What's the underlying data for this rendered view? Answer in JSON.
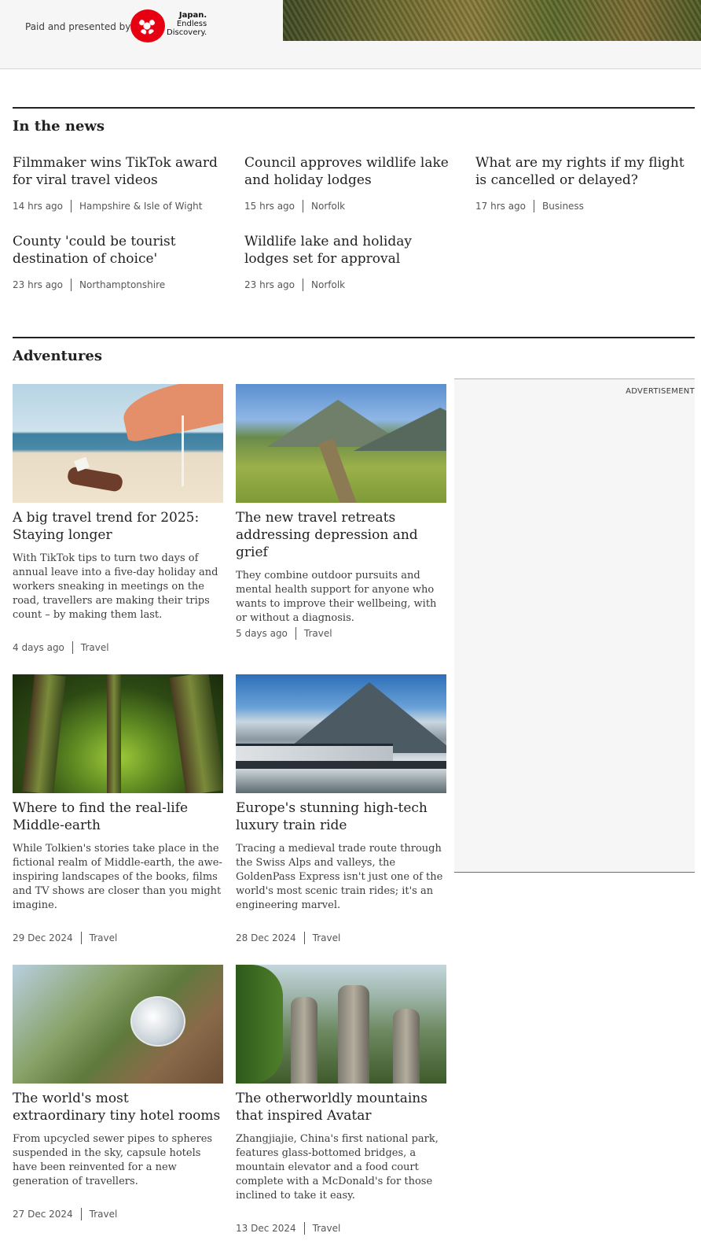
{
  "sponsor": {
    "paid_label": "Paid and presented by",
    "brand_line1": "Japan.",
    "brand_line2": "Endless",
    "brand_line3": "Discovery."
  },
  "in_the_news": {
    "title": "In the news",
    "items": [
      {
        "headline": "Filmmaker wins TikTok award for viral travel videos",
        "time": "14 hrs ago",
        "tag": "Hampshire & Isle of Wight"
      },
      {
        "headline": "Council approves wildlife lake and holiday lodges",
        "time": "15 hrs ago",
        "tag": "Norfolk"
      },
      {
        "headline": "What are my rights if my flight is cancelled or delayed?",
        "time": "17 hrs ago",
        "tag": "Business"
      },
      {
        "headline": "County 'could be tourist destination of choice'",
        "time": "23 hrs ago",
        "tag": "Northamptonshire"
      },
      {
        "headline": "Wildlife lake and holiday lodges set for approval",
        "time": "23 hrs ago",
        "tag": "Norfolk"
      }
    ]
  },
  "adventures": {
    "title": "Adventures",
    "cards": [
      {
        "image_icon": "beach-reading-image",
        "headline": "A big travel trend for 2025: Staying longer",
        "summary": "With TikTok tips to turn two days of annual leave into a five-day holiday and workers sneaking in meetings on the road, travellers are making their trips count – by making them last.",
        "time": "4 days ago",
        "tag": "Travel"
      },
      {
        "image_icon": "hikers-hills-image",
        "headline": "The new travel retreats addressing depression and grief",
        "summary": "They combine outdoor pursuits and mental health support for anyone who wants to improve their wellbeing, with or without a diagnosis.",
        "time": "5 days ago",
        "tag": "Travel"
      },
      {
        "image_icon": "mossy-forest-image",
        "headline": "Where to find the real-life Middle-earth",
        "summary": "While Tolkien's stories take place in the fictional realm of Middle-earth, the awe-inspiring landscapes of the books, films and TV shows are closer than you might imagine.",
        "time": "29 Dec 2024",
        "tag": "Travel"
      },
      {
        "image_icon": "alpine-train-image",
        "headline": "Europe's stunning high-tech luxury train ride",
        "summary": "Tracing a medieval trade route through the Swiss Alps and valleys, the GoldenPass Express isn't just one of the world's most scenic train rides; it's an engineering marvel.",
        "time": "28 Dec 2024",
        "tag": "Travel"
      },
      {
        "image_icon": "capsule-hotel-image",
        "headline": "The world's most extraordinary tiny hotel rooms",
        "summary": "From upcycled sewer pipes to spheres suspended in the sky, capsule hotels have been reinvented for a new generation of travellers.",
        "time": "27 Dec 2024",
        "tag": "Travel"
      },
      {
        "image_icon": "avatar-mountains-image",
        "headline": "The otherworldly mountains that inspired Avatar",
        "summary": "Zhangjiajie, China's first national park, features glass-bottomed bridges, a mountain elevator and a food court complete with a McDonald's for those inclined to take it easy.",
        "time": "13 Dec 2024",
        "tag": "Travel"
      }
    ]
  },
  "advertisement": {
    "label": "ADVERTISEMENT"
  }
}
